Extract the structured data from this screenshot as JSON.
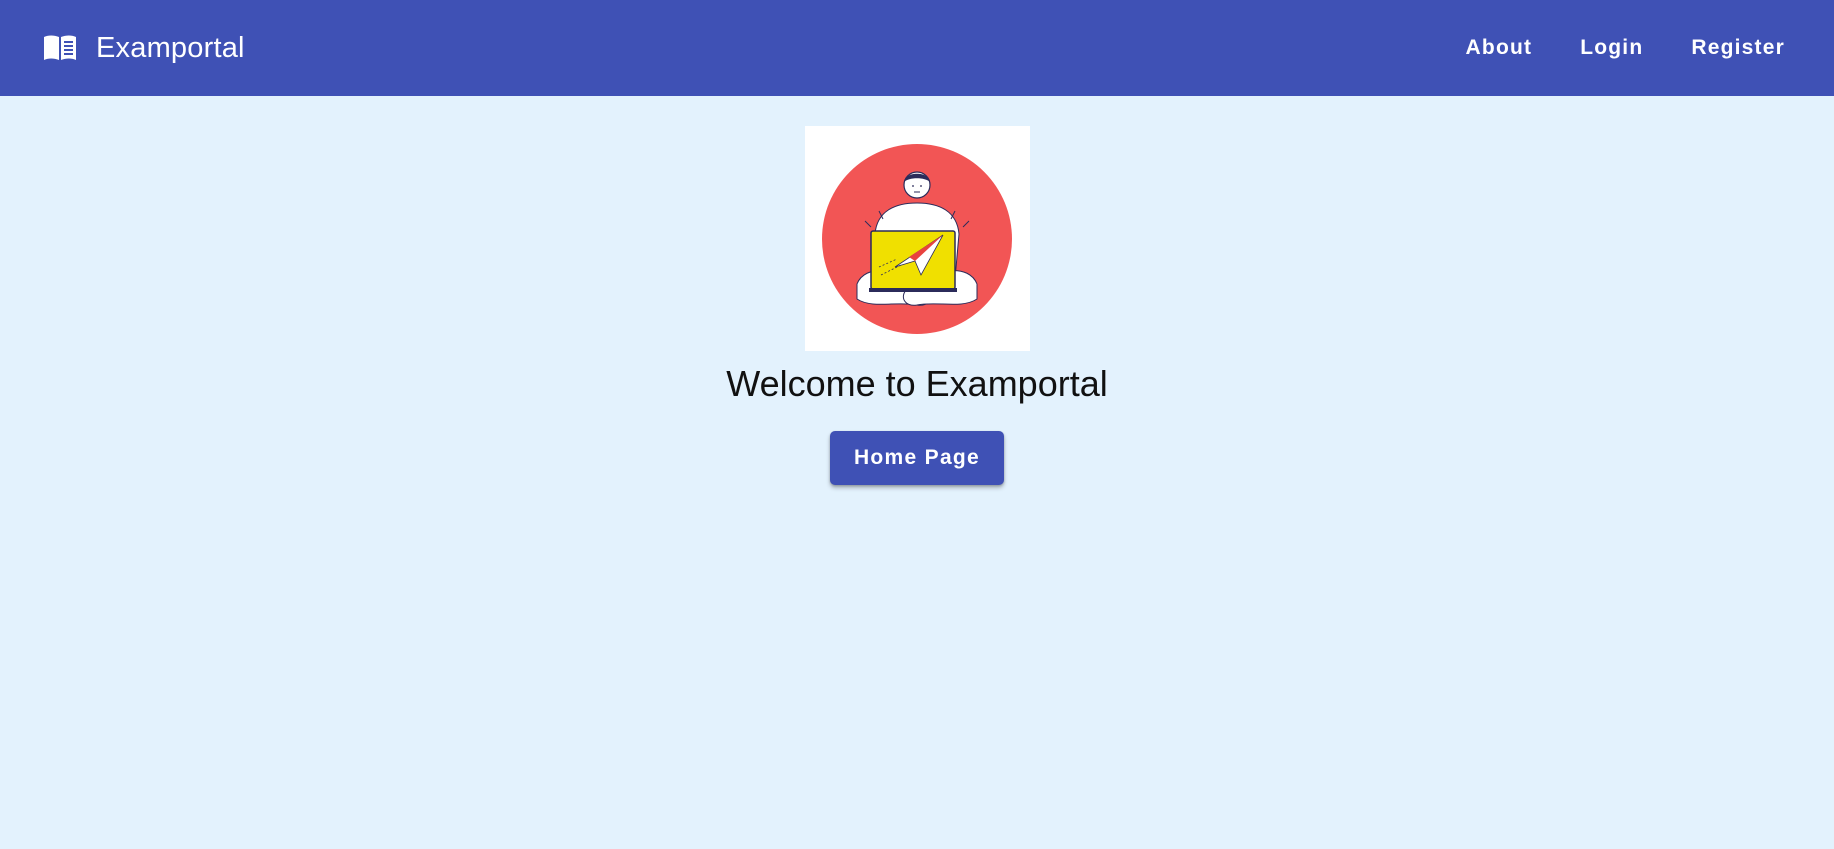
{
  "header": {
    "brand_icon": "menu-book-icon",
    "title": "Examportal",
    "nav": [
      {
        "label": "About"
      },
      {
        "label": "Login"
      },
      {
        "label": "Register"
      }
    ]
  },
  "main": {
    "heading": "Welcome to Examportal",
    "button_label": "Home Page"
  },
  "colors": {
    "primary": "#3f51b5",
    "background": "#e3f2fd"
  }
}
